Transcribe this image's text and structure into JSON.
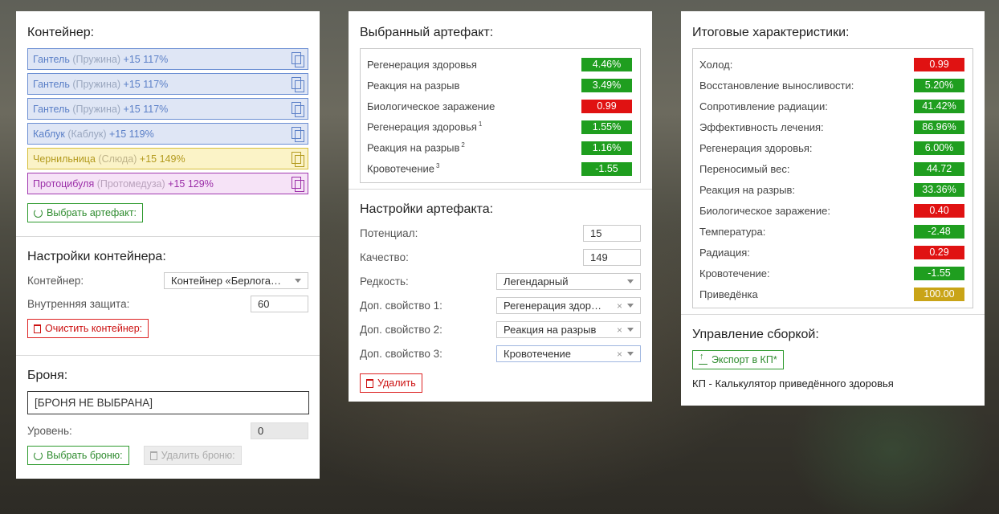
{
  "container_panel": {
    "title": "Контейнер:",
    "items": [
      {
        "name": "Гантель",
        "sub": "(Пружина)",
        "bonus": "+15 117%"
      },
      {
        "name": "Гантель",
        "sub": "(Пружина)",
        "bonus": "+15 117%"
      },
      {
        "name": "Гантель",
        "sub": "(Пружина)",
        "bonus": "+15 117%"
      },
      {
        "name": "Каблук",
        "sub": "(Каблук)",
        "bonus": "+15 119%"
      },
      {
        "name": "Чернильница",
        "sub": "(Слюда)",
        "bonus": "+15 149%"
      },
      {
        "name": "Протоцибуля",
        "sub": "(Протомедуза)",
        "bonus": "+15 129%"
      }
    ],
    "select_artifact_label": "Выбрать артефакт:"
  },
  "container_settings": {
    "title": "Настройки контейнера:",
    "container_label": "Контейнер:",
    "container_value": "Контейнер «Берлога…",
    "protection_label": "Внутренняя защита:",
    "protection_value": "60",
    "clear_label": "Очистить контейнер:"
  },
  "armor": {
    "title": "Броня:",
    "value": "[БРОНЯ НЕ ВЫБРАНА]",
    "level_label": "Уровень:",
    "level_value": "0",
    "select_label": "Выбрать броню:",
    "remove_label": "Удалить броню:"
  },
  "selected_artifact": {
    "title": "Выбранный артефакт:",
    "rows": [
      {
        "label": "Регенерация здоровья",
        "sup": "",
        "value": "4.46%",
        "status": "g"
      },
      {
        "label": "Реакция на разрыв",
        "sup": "",
        "value": "3.49%",
        "status": "g"
      },
      {
        "label": "Биологическое заражение",
        "sup": "",
        "value": "0.99",
        "status": "r"
      },
      {
        "label": "Регенерация здоровья",
        "sup": "1",
        "value": "1.55%",
        "status": "g"
      },
      {
        "label": "Реакция на разрыв",
        "sup": "2",
        "value": "1.16%",
        "status": "g"
      },
      {
        "label": "Кровотечение",
        "sup": "3",
        "value": "-1.55",
        "status": "g"
      }
    ]
  },
  "artifact_settings": {
    "title": "Настройки артефакта:",
    "potential_label": "Потенциал:",
    "potential_value": "15",
    "quality_label": "Качество:",
    "quality_value": "149",
    "rarity_label": "Редкость:",
    "rarity_value": "Легендарный",
    "prop1_label": "Доп. свойство 1:",
    "prop1_value": "Регенерация здор…",
    "prop2_label": "Доп. свойство 2:",
    "prop2_value": "Реакция на разрыв",
    "prop3_label": "Доп. свойство 3:",
    "prop3_value": "Кровотечение",
    "clear_x": "×",
    "delete_label": "Удалить"
  },
  "totals": {
    "title": "Итоговые характеристики:",
    "rows": [
      {
        "label": "Холод:",
        "value": "0.99",
        "status": "r"
      },
      {
        "label": "Восстановление выносливости:",
        "value": "5.20%",
        "status": "g"
      },
      {
        "label": "Сопротивление радиации:",
        "value": "41.42%",
        "status": "g"
      },
      {
        "label": "Эффективность лечения:",
        "value": "86.96%",
        "status": "g"
      },
      {
        "label": "Регенерация здоровья:",
        "value": "6.00%",
        "status": "g"
      },
      {
        "label": "Переносимый вес:",
        "value": "44.72",
        "status": "g"
      },
      {
        "label": "Реакция на разрыв:",
        "value": "33.36%",
        "status": "g"
      },
      {
        "label": "Биологическое заражение:",
        "value": "0.40",
        "status": "r"
      },
      {
        "label": "Температура:",
        "value": "-2.48",
        "status": "g"
      },
      {
        "label": "Радиация:",
        "value": "0.29",
        "status": "r"
      },
      {
        "label": "Кровотечение:",
        "value": "-1.55",
        "status": "g"
      },
      {
        "label": "Приведёнка",
        "value": "100.00",
        "status": "y"
      }
    ]
  },
  "build_management": {
    "title": "Управление сборкой:",
    "export_label": "Экспорт в КП*",
    "note": "КП - Калькулятор приведённого здоровья"
  },
  "colors": {
    "green": "#1f9e1f",
    "red": "#e01212",
    "yellow": "#c9a417",
    "blue_item": "#5a7fc7",
    "purple_item": "#9b2fa8"
  }
}
